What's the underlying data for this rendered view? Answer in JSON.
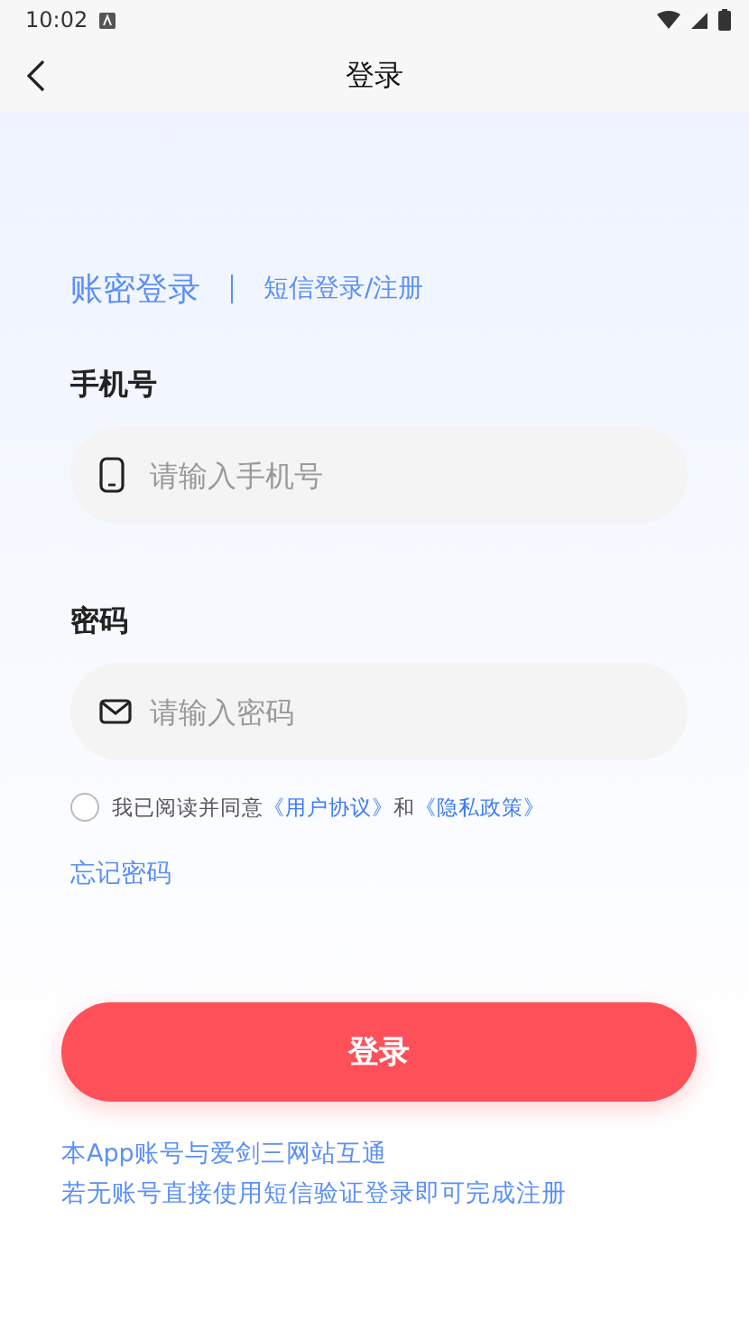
{
  "status_bar": {
    "time": "10:02"
  },
  "nav": {
    "title": "登录"
  },
  "tabs": [
    {
      "label": "账密登录",
      "selected": true
    },
    {
      "label": "短信登录/注册",
      "selected": false
    }
  ],
  "fields": [
    {
      "label": "手机号",
      "placeholder": "请输入手机号",
      "kind": "phone"
    },
    {
      "label": "密码",
      "placeholder": "请输入密码",
      "kind": "password"
    }
  ],
  "agreement": {
    "checked": false,
    "parts": [
      {
        "kind": "text",
        "text": "我已阅读并同意"
      },
      {
        "kind": "link",
        "text": "《用户协议》"
      },
      {
        "kind": "text",
        "text": "和"
      },
      {
        "kind": "link",
        "text": "《隐私政策》"
      }
    ]
  },
  "forgot_link": "忘记密码",
  "login_button": "登录",
  "notes": [
    "本App账号与爱剑三网站互通",
    "若无账号直接使用短信验证登录即可完成注册"
  ]
}
